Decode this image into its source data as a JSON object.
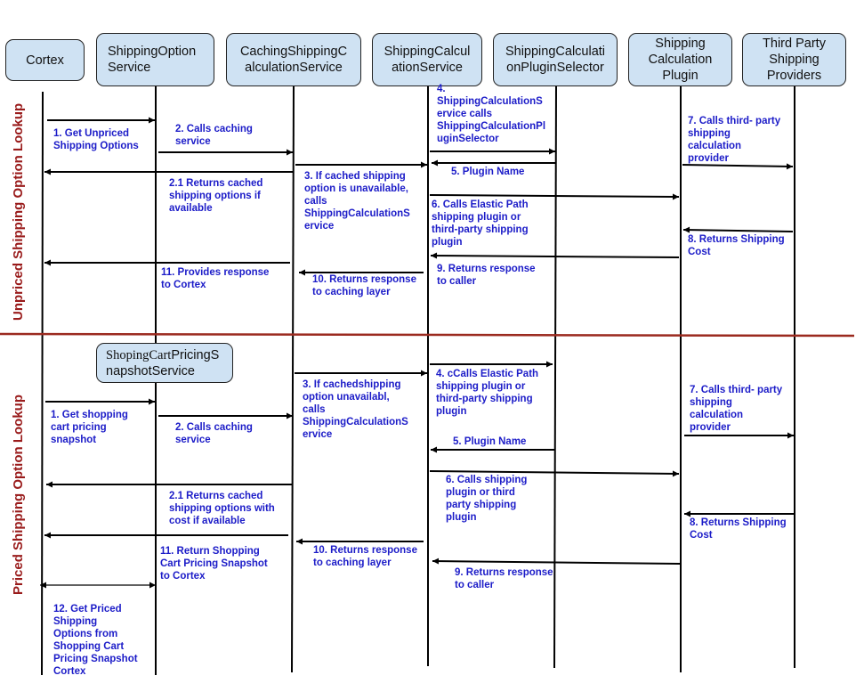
{
  "colors": {
    "actor_fill": "#cfe2f3",
    "message_text": "#1c1cc8",
    "section_label": "#991b1b",
    "divider": "#9b2a1f",
    "line": "#000000"
  },
  "actors": [
    {
      "id": "cortex",
      "label": "Cortex"
    },
    {
      "id": "shipping-option-service",
      "label": "ShippingOption\nService"
    },
    {
      "id": "caching-shipping-calculation-service",
      "label": "CachingShippingC\nalculationService"
    },
    {
      "id": "shipping-calculation-service",
      "label": "ShippingCalcul\nationService"
    },
    {
      "id": "shipping-calculation-plugin-selector",
      "label": "ShippingCalculati\nonPluginSelector"
    },
    {
      "id": "shipping-calculation-plugin",
      "label": "Shipping\nCalculation\nPlugin"
    },
    {
      "id": "third-party-shipping-providers",
      "label": "Third Party\nShipping\nProviders"
    }
  ],
  "snapshot_actor": {
    "label_part1": "ShopingCart",
    "label_part2": "PricingS\nnapshotService"
  },
  "sections": {
    "unpriced": "Unpriced Shipping Option Lookup",
    "priced": "Priced Shipping Option Lookup"
  },
  "unpriced_messages": [
    {
      "step": "1",
      "from": "cortex",
      "to": "shipping-option-service",
      "text": "1. Get Unpriced\nShipping Options"
    },
    {
      "step": "2",
      "from": "shipping-option-service",
      "to": "caching-shipping-calculation-service",
      "text": "2. Calls caching\nservice"
    },
    {
      "step": "2.1",
      "from": "caching-shipping-calculation-service",
      "to": "cortex",
      "text": "2.1 Returns cached\nshipping options if\navailable"
    },
    {
      "step": "3",
      "from": "caching-shipping-calculation-service",
      "to": "shipping-calculation-service",
      "text": "3. If cached shipping\noption is unavailable,\ncalls\nShippingCalculationS\nervice"
    },
    {
      "step": "4",
      "from": "shipping-calculation-service",
      "to": "shipping-calculation-plugin-selector",
      "text": "4.\nShippingCalculationS\nervice calls\nShippingCalculationPl\nuginSelector"
    },
    {
      "step": "5",
      "from": "shipping-calculation-plugin-selector",
      "to": "shipping-calculation-service",
      "text": "5. Plugin Name"
    },
    {
      "step": "6",
      "from": "shipping-calculation-service",
      "to": "shipping-calculation-plugin",
      "text": "6. Calls Elastic Path\nshipping plugin or\nthird-party shipping\nplugin"
    },
    {
      "step": "7",
      "from": "shipping-calculation-plugin",
      "to": "third-party-shipping-providers",
      "text": "7. Calls third- party\nshipping\ncalculation\nprovider"
    },
    {
      "step": "8",
      "from": "third-party-shipping-providers",
      "to": "shipping-calculation-plugin",
      "text": "8. Returns Shipping\nCost"
    },
    {
      "step": "9",
      "from": "shipping-calculation-plugin",
      "to": "shipping-calculation-service",
      "text": "9. Returns response\nto caller"
    },
    {
      "step": "10",
      "from": "shipping-calculation-service",
      "to": "caching-shipping-calculation-service",
      "text": "10. Returns response\nto caching layer"
    },
    {
      "step": "11",
      "from": "caching-shipping-calculation-service",
      "to": "cortex",
      "text": "11. Provides response\nto Cortex"
    }
  ],
  "priced_messages": [
    {
      "step": "1",
      "from": "cortex",
      "to": "shopping-cart-pricing-snapshot-service",
      "text": "1. Get shopping\ncart pricing\nsnapshot"
    },
    {
      "step": "2",
      "from": "shopping-cart-pricing-snapshot-service",
      "to": "caching-shipping-calculation-service",
      "text": "2. Calls caching\nservice"
    },
    {
      "step": "2.1",
      "from": "caching-shipping-calculation-service",
      "to": "cortex",
      "text": "2.1 Returns cached\nshipping options with\ncost if  available"
    },
    {
      "step": "3",
      "from": "caching-shipping-calculation-service",
      "to": "shipping-calculation-service",
      "text": "3. If cachedshipping\noption  unavailabl,\ncalls\nShippingCalculationS\nervice"
    },
    {
      "step": "4",
      "from": "shipping-calculation-service",
      "to": "shipping-calculation-plugin-selector",
      "text": "4. cCalls Elastic Path\nshipping plugin or\nthird-party shipping\nplugin"
    },
    {
      "step": "5",
      "from": "shipping-calculation-plugin-selector",
      "to": "shipping-calculation-service",
      "text": "5. Plugin Name"
    },
    {
      "step": "6",
      "from": "shipping-calculation-service",
      "to": "shipping-calculation-plugin",
      "text": "6. Calls shipping\nplugin or third\nparty shipping\nplugin"
    },
    {
      "step": "7",
      "from": "shipping-calculation-plugin",
      "to": "third-party-shipping-providers",
      "text": "7. Calls third- party\nshipping\ncalculation\nprovider"
    },
    {
      "step": "8",
      "from": "third-party-shipping-providers",
      "to": "shipping-calculation-plugin",
      "text": "8. Returns Shipping\nCost"
    },
    {
      "step": "9",
      "from": "shipping-calculation-plugin",
      "to": "shipping-calculation-service",
      "text": "9. Returns response\nto caller"
    },
    {
      "step": "10",
      "from": "shipping-calculation-service",
      "to": "caching-shipping-calculation-service",
      "text": "10. Returns response\nto caching layer"
    },
    {
      "step": "11",
      "from": "caching-shipping-calculation-service",
      "to": "cortex",
      "text": "11. Return Shopping\nCart Pricing Snapshot\nto Cortex"
    },
    {
      "step": "12",
      "from": "cortex",
      "to": "shopping-cart-pricing-snapshot-service",
      "text": "12. Get Priced\nShipping\nOptions from\nShopping Cart\nPricing Snapshot\n Cortex"
    }
  ]
}
